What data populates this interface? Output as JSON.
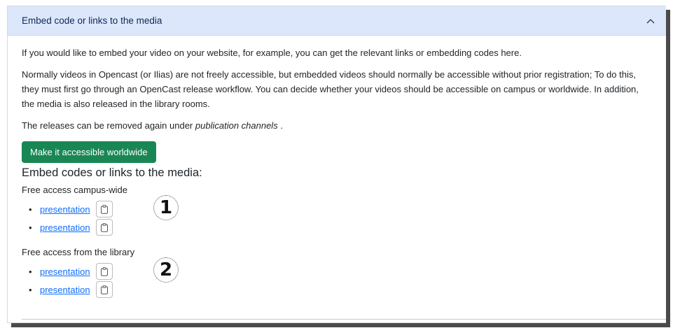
{
  "accordion": {
    "title": "Embed code or links to the media"
  },
  "intro": {
    "p1": "If you would like to embed your video on your website, for example, you can get the relevant links or embedding codes here.",
    "p2": "Normally videos in Opencast (or Ilias) are not freely accessible, but embedded videos should normally be accessible without prior registration; To do this, they must first go through an OpenCast release workflow. You can decide whether your videos should be accessible on campus or worldwide. In addition, the media is also released in the library rooms.",
    "p3_prefix": "The releases can be removed again under ",
    "p3_em": "publication channels",
    "p3_suffix": " ."
  },
  "make_accessible_button": "Make it accessible worldwide",
  "section_heading": "Embed codes or links to the media:",
  "groups": [
    {
      "label": "Free access campus-wide",
      "marker": "1",
      "links": [
        "presentation",
        "presentation"
      ]
    },
    {
      "label": "Free access from the library",
      "marker": "2",
      "links": [
        "presentation",
        "presentation"
      ]
    }
  ],
  "colors": {
    "header_bg": "#dde7fb",
    "button_bg": "#198754",
    "link": "#0d6efd"
  },
  "icons": {
    "header_toggle": "chevron-up-icon",
    "copy": "clipboard-icon"
  }
}
